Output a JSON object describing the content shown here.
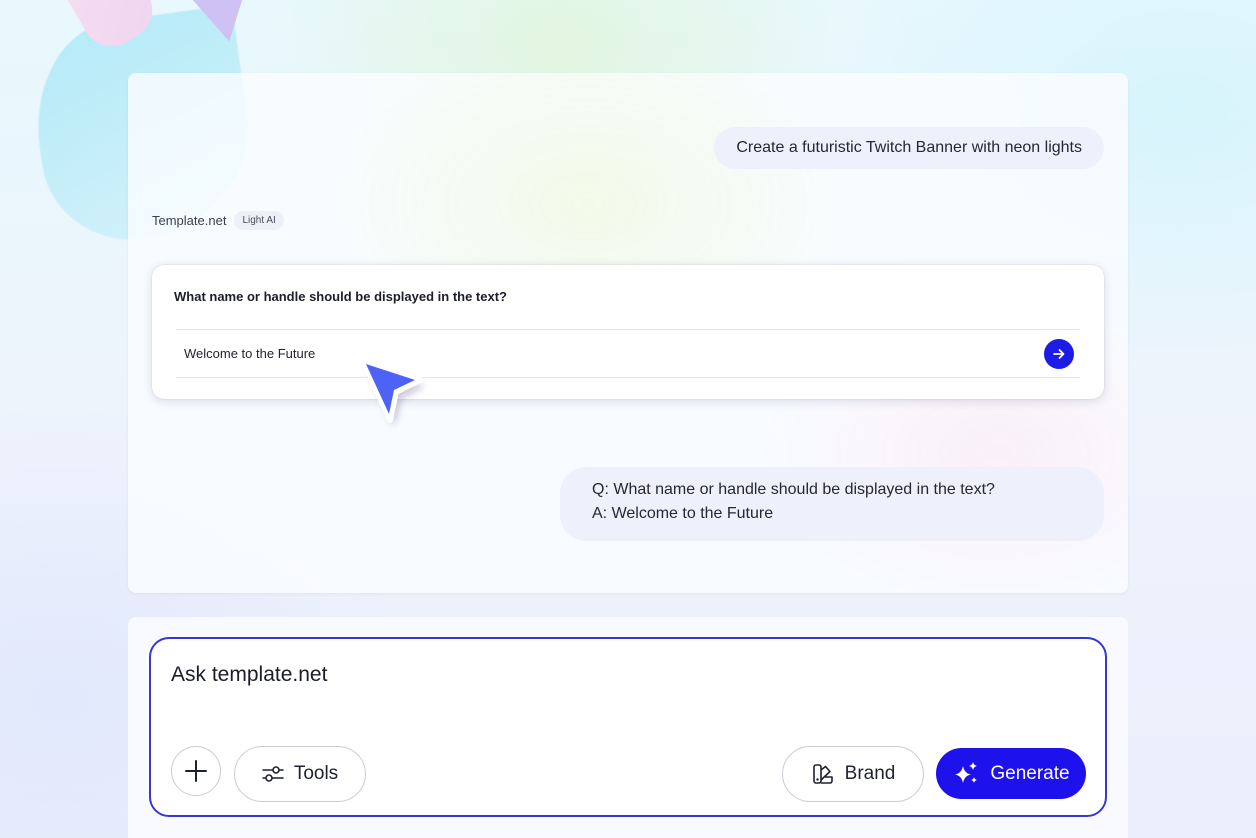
{
  "chat": {
    "user_prompt": "Create a futuristic Twitch Banner with neon lights",
    "assistant_name": "Template.net",
    "assistant_badge": "Light AI",
    "question_card": {
      "question": "What name or handle should be displayed in the text?",
      "answer": "Welcome to the Future",
      "send_icon": "arrow-right-icon"
    },
    "qa_summary": {
      "question_line": "Q: What name or handle should be displayed in the text?",
      "answer_line": "A: Welcome to the Future"
    }
  },
  "composer": {
    "placeholder": "Ask template.net",
    "add_icon": "plus-icon",
    "tools_label": "Tools",
    "tools_icon": "sliders-icon",
    "brand_label": "Brand",
    "brand_icon": "palette-swatch-icon",
    "generate_label": "Generate",
    "generate_icon": "sparkles-icon"
  },
  "colors": {
    "accent": "#1d12ec",
    "prompt_border": "#3a36d3",
    "cursor": "#4d63f5"
  }
}
